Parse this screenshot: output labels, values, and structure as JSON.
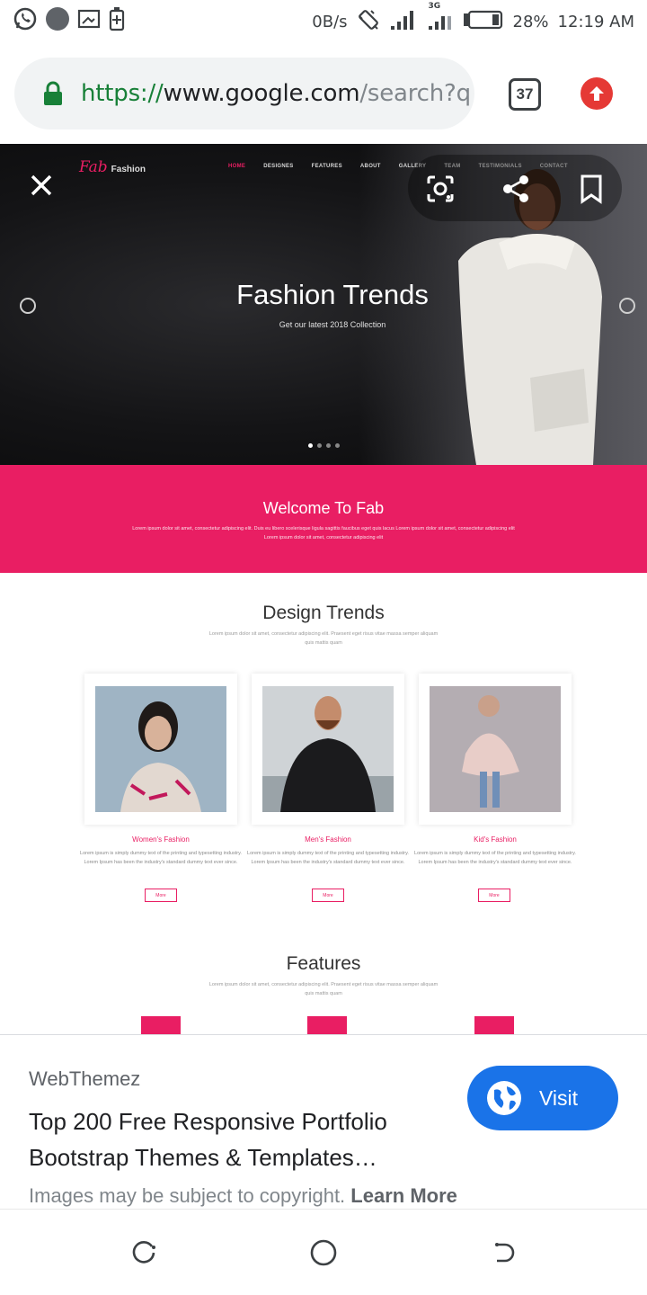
{
  "status_bar": {
    "network_speed": "0B/s",
    "network_type": "3G",
    "battery": "28%",
    "time": "12:19 AM",
    "icons": [
      "whatsapp-icon",
      "app-notification-icon",
      "screenshot-icon",
      "battery-saver-icon",
      "vibrate-icon",
      "signal-icon",
      "battery-icon"
    ]
  },
  "browser": {
    "url_scheme": "https://",
    "url_host": "www.google.com",
    "url_path": "/search?q",
    "tab_count": "37"
  },
  "image": {
    "site_logo": "Fab",
    "site_logo_suffix": "Fashion",
    "nav_items": [
      "HOME",
      "DESIGNES",
      "FEATURES",
      "ABOUT",
      "GALLERY",
      "TEAM",
      "TESTIMONIALS",
      "CONTACT"
    ],
    "hero_title": "Fashion Trends",
    "hero_subtitle": "Get our latest 2018 Collection",
    "welcome_title": "Welcome To Fab",
    "welcome_text": "Lorem ipsum dolor sit amet, consectetur adipiscing elit. Duis eu libero scelerisque ligula sagittis faucibus eget quis lacus Lorem ipsum dolor sit amet, consectetur adipiscing elit Lorem ipsum dolor sit amet, consectetur adipiscing elit",
    "design_title": "Design Trends",
    "design_sub": "Lorem ipsum dolor sit amet, consectetur adipiscing elit. Praesent eget risus vitae massa semper aliquam quis mattis quam",
    "cards": [
      {
        "title": "Women's Fashion",
        "text": "Lorem ipsum is simply dummy text of the printing and typesetting industry. Lorem Ipsum has been the industry's standard dummy text ever since.",
        "button": "More"
      },
      {
        "title": "Men's Fashion",
        "text": "Lorem ipsum is simply dummy text of the printing and typesetting industry. Lorem Ipsum has been the industry's standard dummy text ever since.",
        "button": "More"
      },
      {
        "title": "Kid's Fashion",
        "text": "Lorem ipsum is simply dummy text of the printing and typesetting industry. Lorem Ipsum has been the industry's standard dummy text ever since.",
        "button": "More"
      }
    ],
    "features_title": "Features",
    "features_sub": "Lorem ipsum dolor sit amet, consectetur adipiscing elit. Praesent eget risus vitae massa semper aliquam quis mattis quam"
  },
  "info": {
    "source": "WebThemez",
    "title": "Top 200 Free Responsive Portfolio Bootstrap Themes & Templates…",
    "visit_label": "Visit",
    "copyright": "Images may be subject to copyright.",
    "learn_more": "Learn More"
  },
  "colors": {
    "accent_pink": "#e91e63",
    "visit_blue": "#1a73e8",
    "secure_green": "#188038"
  }
}
